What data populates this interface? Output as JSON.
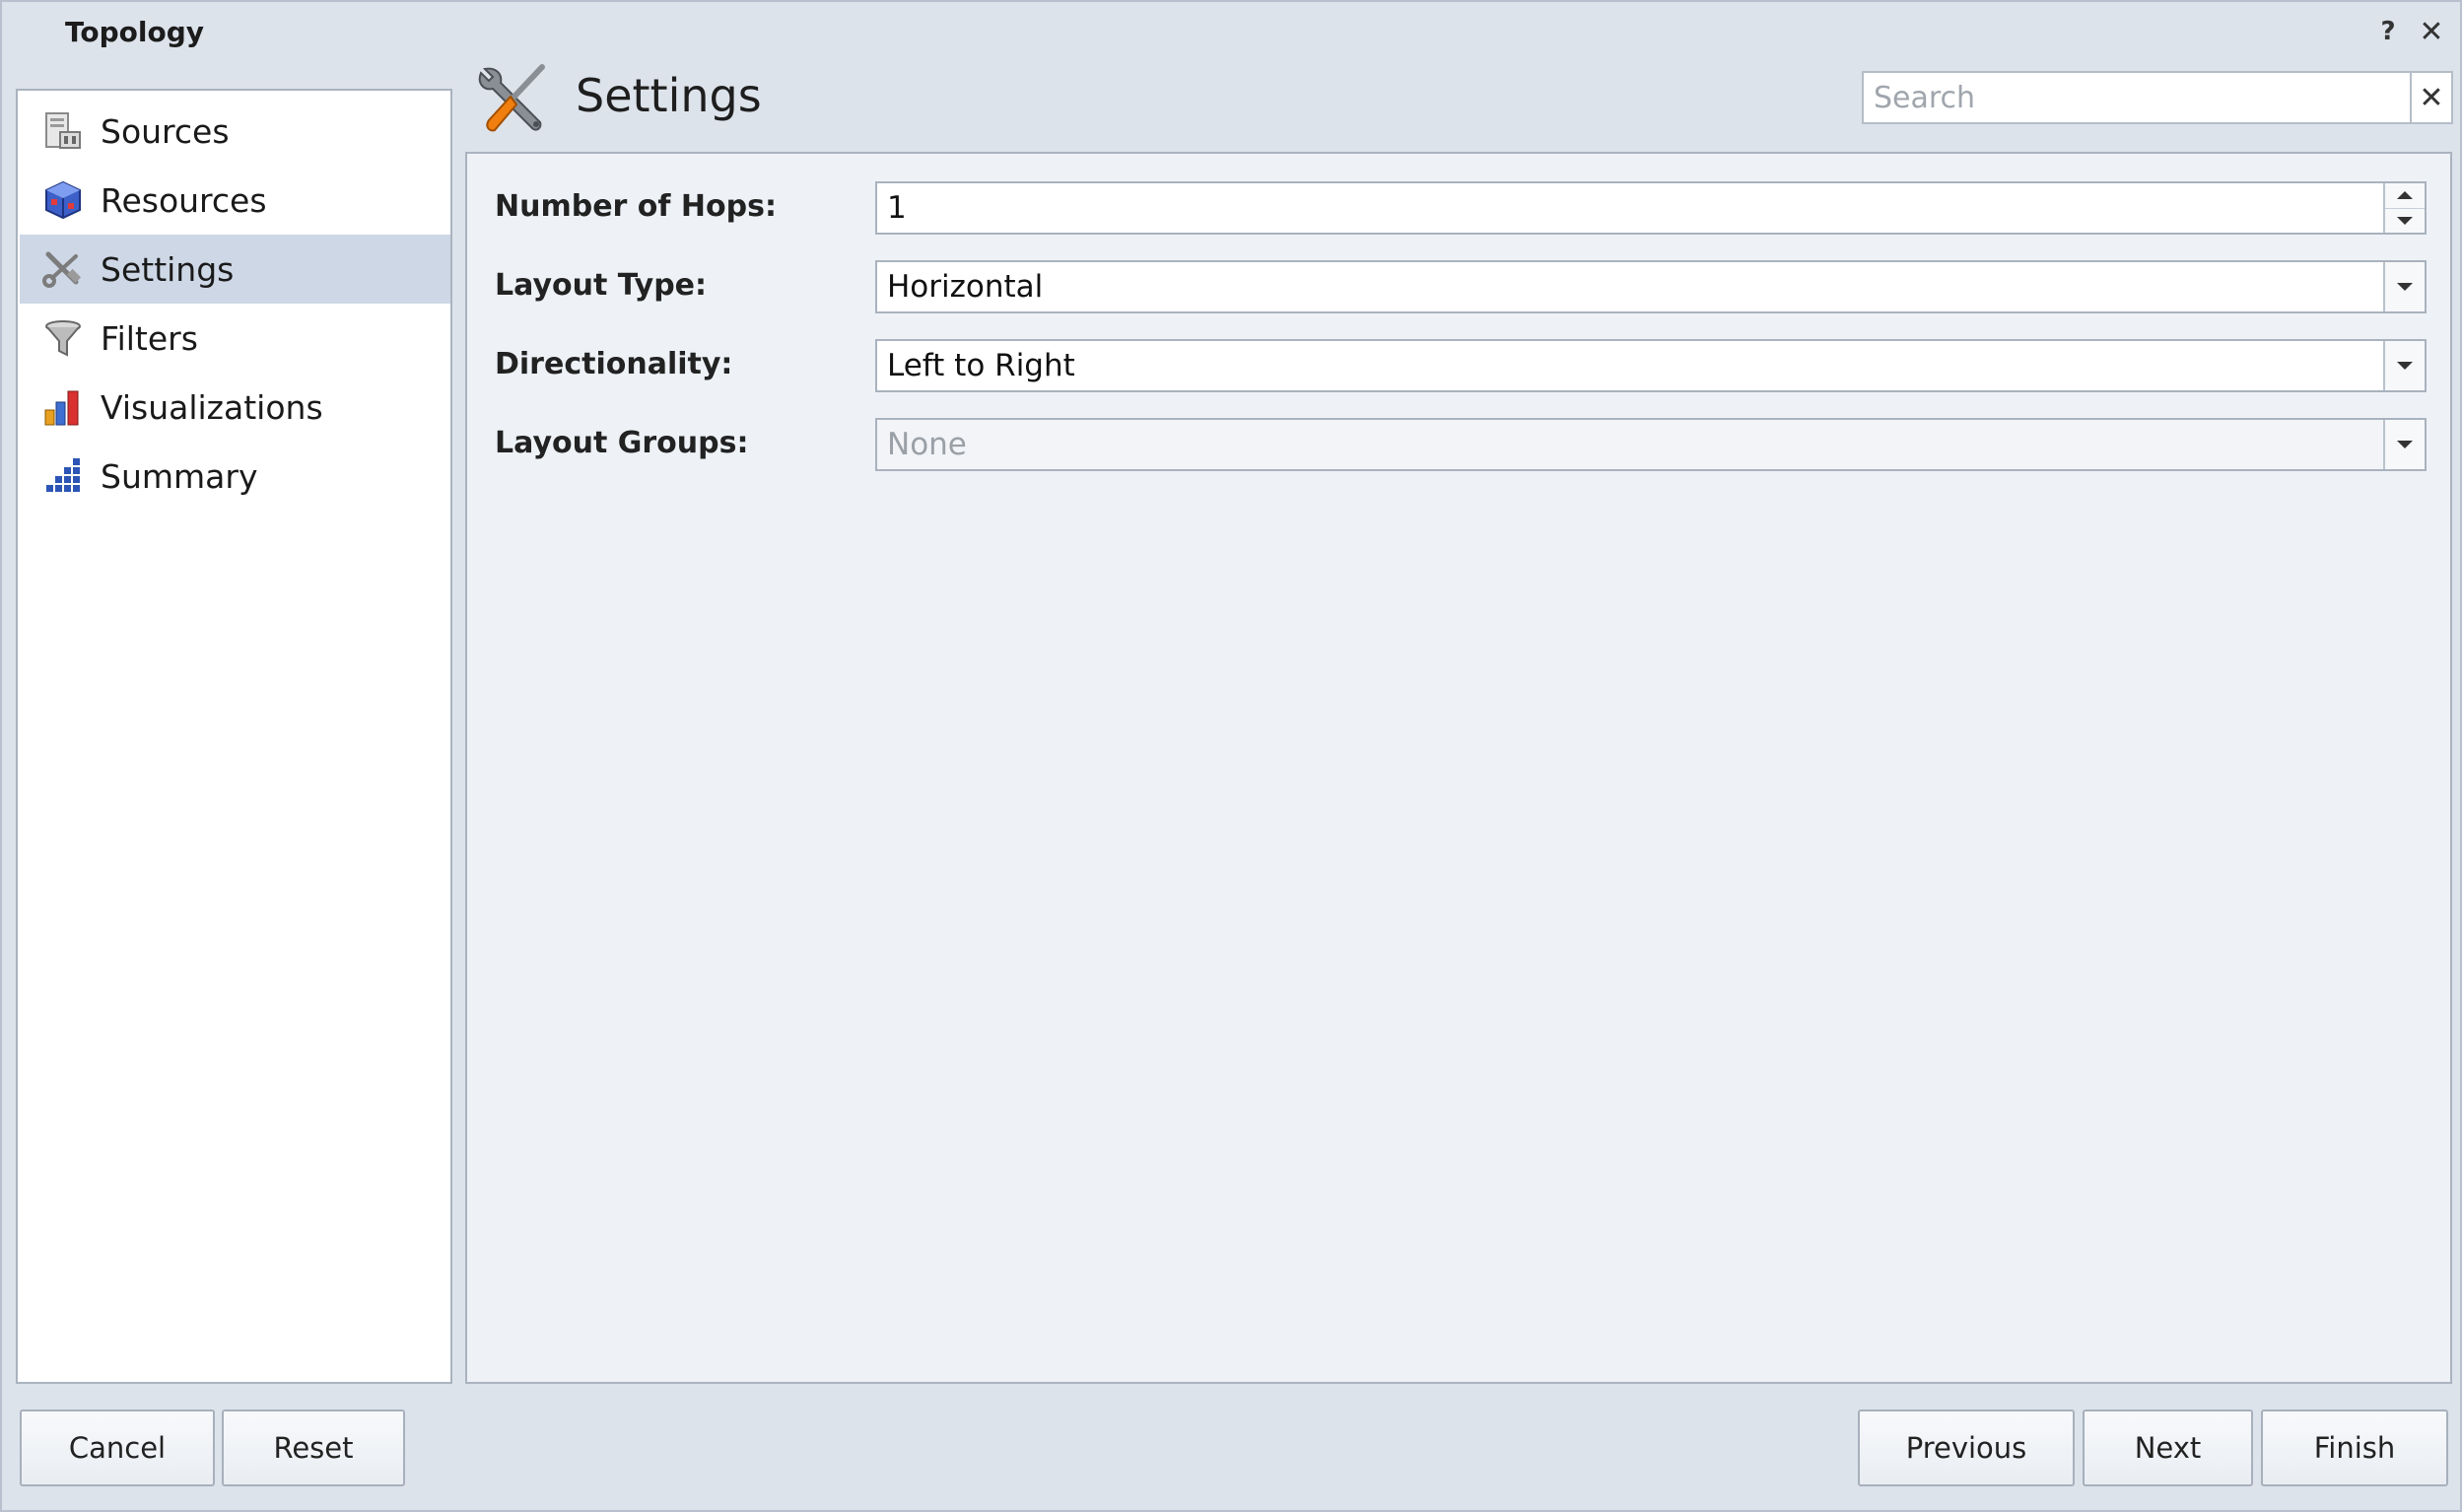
{
  "window": {
    "title": "Topology",
    "help_label": "?",
    "close_label": "✕"
  },
  "sidebar": {
    "items": [
      {
        "label": "Sources",
        "icon": "sources-icon"
      },
      {
        "label": "Resources",
        "icon": "resources-icon"
      },
      {
        "label": "Settings",
        "icon": "settings-icon",
        "selected": true
      },
      {
        "label": "Filters",
        "icon": "filter-icon"
      },
      {
        "label": "Visualizations",
        "icon": "bar-chart-icon"
      },
      {
        "label": "Summary",
        "icon": "summary-icon"
      }
    ]
  },
  "header": {
    "title": "Settings",
    "icon": "wrench-screwdriver-icon"
  },
  "search": {
    "placeholder": "Search",
    "value": "",
    "clear_label": "✕"
  },
  "form": {
    "hops": {
      "label": "Number of Hops:",
      "value": "1"
    },
    "layout_type": {
      "label": "Layout Type:",
      "value": "Horizontal"
    },
    "directionality": {
      "label": "Directionality:",
      "value": "Left to Right"
    },
    "layout_groups": {
      "label": "Layout Groups:",
      "value": "None",
      "disabled": true
    }
  },
  "footer": {
    "cancel_label": "Cancel",
    "reset_label": "Reset",
    "previous_label": "Previous",
    "next_label": "Next",
    "finish_label": "Finish"
  },
  "colors": {
    "selected_bg": "#cdd7e5",
    "window_bg": "#dde3eb",
    "panel_bg": "#eef2f6",
    "accent_orange": "#f07f0f"
  }
}
